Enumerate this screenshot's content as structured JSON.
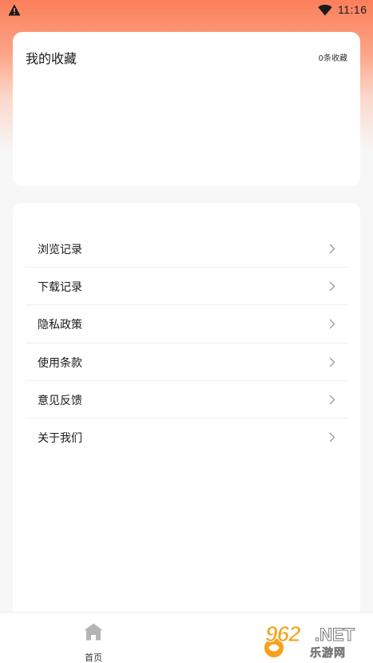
{
  "status_bar": {
    "time": "11:16",
    "left_icon": "warning-icon",
    "right_icon": "wifi-icon"
  },
  "favorites": {
    "title": "我的收藏",
    "count": "0条收藏"
  },
  "menu": {
    "items": [
      {
        "label": "浏览记录",
        "icon": "chevron-right-icon"
      },
      {
        "label": "下载记录",
        "icon": "chevron-right-icon"
      },
      {
        "label": "隐私政策",
        "icon": "chevron-right-icon"
      },
      {
        "label": "使用条款",
        "icon": "chevron-right-icon"
      },
      {
        "label": "意见反馈",
        "icon": "chevron-right-icon"
      },
      {
        "label": "关于我们",
        "icon": "chevron-right-icon"
      }
    ]
  },
  "bottom_nav": {
    "home_label": "首页",
    "home_icon": "home-icon"
  },
  "watermark": {
    "brand_number": "962",
    "brand_tld": ".NET",
    "brand_sub": "乐游网"
  },
  "colors": {
    "header_gradient_top": "#fb7f5a",
    "page_background": "#f7f7f7",
    "card_background": "#ffffff",
    "watermark_orange": "#f4a21c"
  }
}
